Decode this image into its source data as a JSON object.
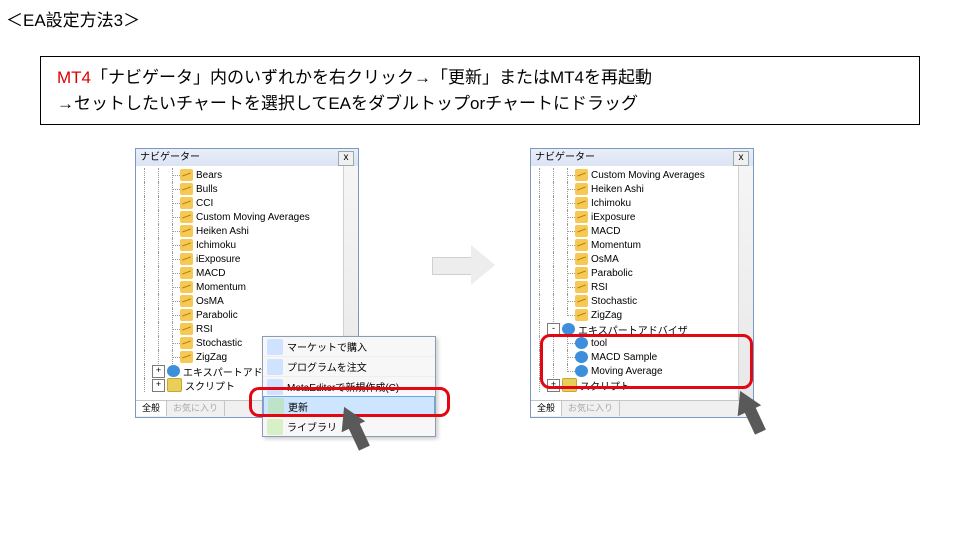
{
  "title": "＜EA設定方法3＞",
  "callout": {
    "mt4": "MT4",
    "line1rest": "「ナビゲータ」内のいずれかを右クリック→「更新」またはMT4を再起動",
    "line2": "→セットしたいチャートを選択してEAをダブルトップorチャートにドラッグ"
  },
  "navigator_header": "ナビゲーター",
  "close_x": "x",
  "tabs": {
    "all": "全般",
    "fav": "お気に入り"
  },
  "plus": "+",
  "minus": "-",
  "left_panel": {
    "indicators": [
      "Bears",
      "Bulls",
      "CCI",
      "Custom Moving Averages",
      "Heiken Ashi",
      "Ichimoku",
      "iExposure",
      "MACD",
      "Momentum",
      "OsMA",
      "Parabolic",
      "RSI",
      "Stochastic",
      "ZigZag"
    ],
    "group_ea": "エキスパートアドバイザ",
    "group_script": "スクリプト"
  },
  "right_panel": {
    "indicators": [
      "Custom Moving Averages",
      "Heiken Ashi",
      "Ichimoku",
      "iExposure",
      "MACD",
      "Momentum",
      "OsMA",
      "Parabolic",
      "RSI",
      "Stochastic",
      "ZigZag"
    ],
    "group_ea": "エキスパートアドバイザ",
    "eas": [
      "tool",
      "MACD Sample",
      "Moving Average"
    ],
    "group_script": "スクリプト"
  },
  "context_menu": {
    "buy": "マーケットで購入",
    "order": "プログラムを注文",
    "metaeditor": "MetaEditorで新規作成(C)",
    "refresh": "更新",
    "library": "ライブラリ"
  }
}
